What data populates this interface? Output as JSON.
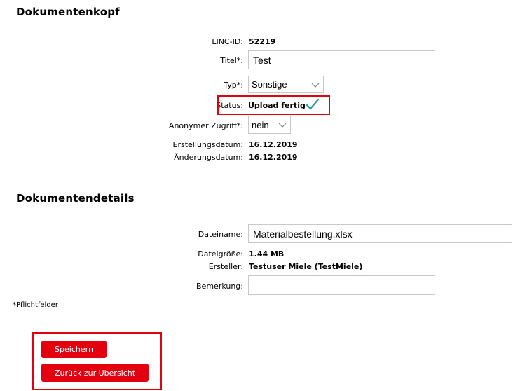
{
  "header": {
    "title": "Dokumentenkopf",
    "fields": {
      "linc_id": {
        "label": "LINC-ID:",
        "value": "52219"
      },
      "titel": {
        "label": "Titel*:",
        "value": "Test"
      },
      "typ": {
        "label": "Typ*:",
        "value": "Sonstige"
      },
      "status": {
        "label": "Status:",
        "value": "Upload fertig",
        "icon": "checkmark-icon"
      },
      "anonymer_zugriff": {
        "label": "Anonymer Zugriff*:",
        "value": "nein"
      },
      "erstellungsdatum": {
        "label": "Erstellungsdatum:",
        "value": "16.12.2019"
      },
      "aenderungsdatum": {
        "label": "Änderungsdatum:",
        "value": "16.12.2019"
      }
    }
  },
  "details": {
    "title": "Dokumentendetails",
    "fields": {
      "dateiname": {
        "label": "Dateiname:",
        "value": "Materialbestellung.xlsx"
      },
      "dateigroesse": {
        "label": "Dateigröße:",
        "value": "1.44 MB"
      },
      "ersteller": {
        "label": "Ersteller:",
        "value": "Testuser Miele (TestMiele)"
      },
      "bemerkung": {
        "label": "Bemerkung:",
        "value": ""
      }
    }
  },
  "footnote": "*Pflichtfelder",
  "actions": {
    "save_label": "Speichern",
    "back_label": "Zurück zur Übersicht"
  },
  "colors": {
    "accent": "#e3000f",
    "check": "#2a9d8f"
  }
}
